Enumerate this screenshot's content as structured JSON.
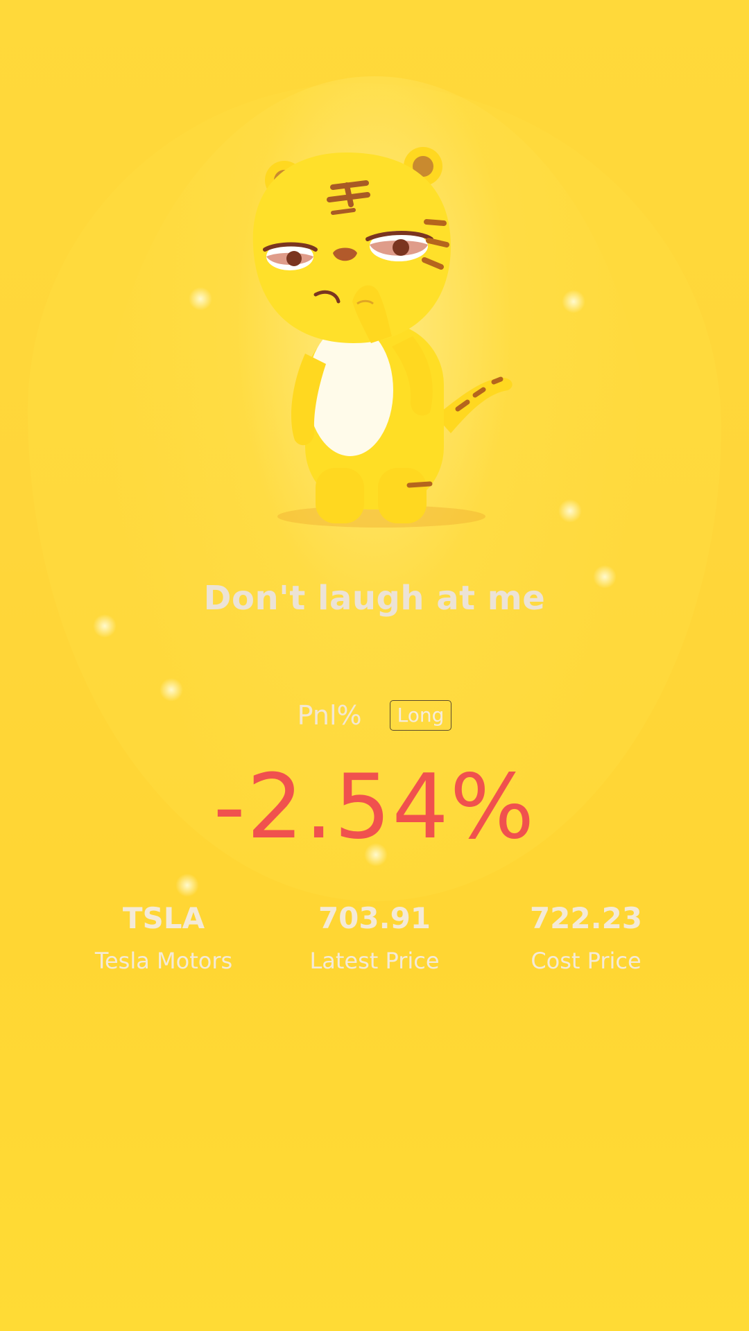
{
  "mascot": {
    "name": "tiger-mascot-illustration"
  },
  "tagline": "Don't laugh at me",
  "pnl": {
    "label": "Pnl%",
    "position_type": "Long",
    "value": "-2.54%",
    "value_color": "#f0514e"
  },
  "stats": [
    {
      "value": "TSLA",
      "label": "Tesla Motors"
    },
    {
      "value": "703.91",
      "label": "Latest Price"
    },
    {
      "value": "722.23",
      "label": "Cost Price"
    }
  ],
  "colors": {
    "background": "#ffd63a",
    "accent_negative": "#f0514e"
  }
}
